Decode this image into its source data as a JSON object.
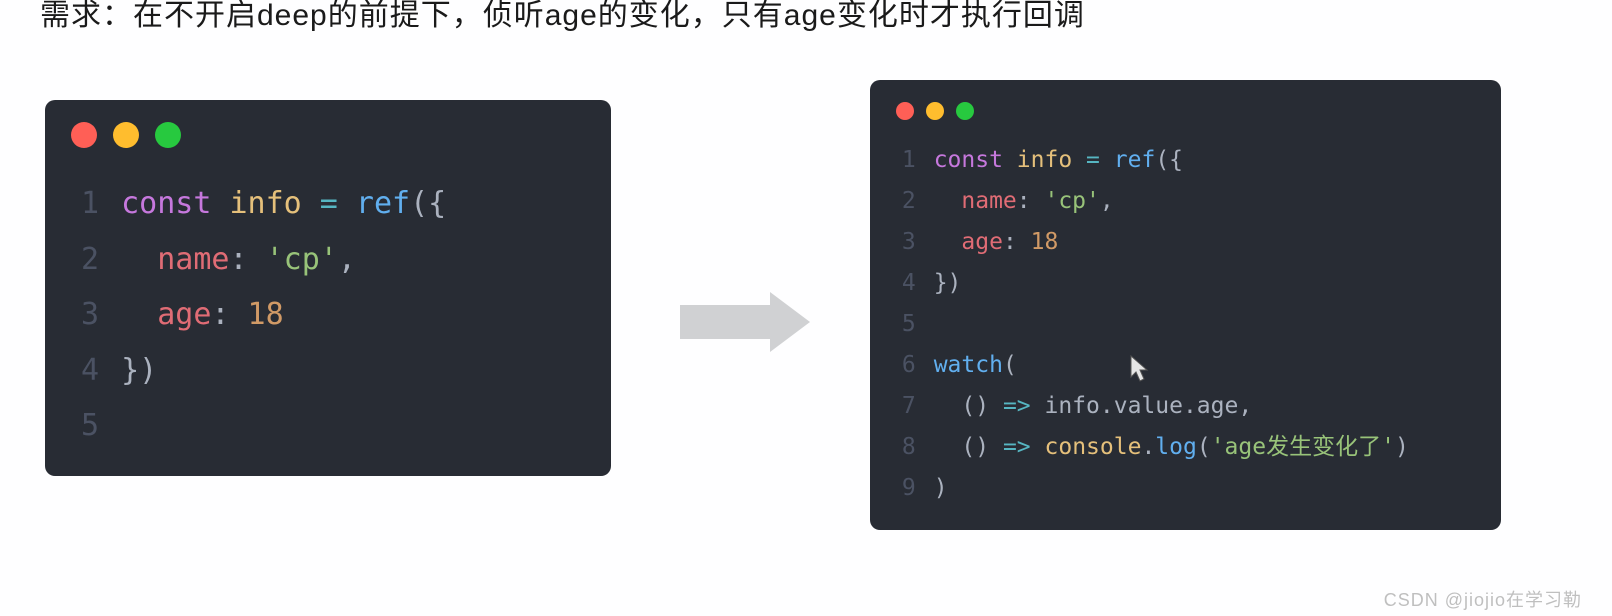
{
  "heading": "需求：在不开启deep的前提下，侦听age的变化，只有age变化时才执行回调",
  "left_code": {
    "lines": [
      {
        "n": "1",
        "tokens": [
          [
            "kw",
            "const"
          ],
          [
            "plain",
            " "
          ],
          [
            "var",
            "info"
          ],
          [
            "plain",
            " "
          ],
          [
            "op",
            "="
          ],
          [
            "plain",
            " "
          ],
          [
            "fn",
            "ref"
          ],
          [
            "plain",
            "({"
          ]
        ]
      },
      {
        "n": "2",
        "tokens": [
          [
            "plain",
            "  "
          ],
          [
            "prop",
            "name"
          ],
          [
            "plain",
            ": "
          ],
          [
            "str",
            "'cp'"
          ],
          [
            "plain",
            ","
          ]
        ]
      },
      {
        "n": "3",
        "tokens": [
          [
            "plain",
            "  "
          ],
          [
            "prop",
            "age"
          ],
          [
            "plain",
            ": "
          ],
          [
            "num",
            "18"
          ]
        ]
      },
      {
        "n": "4",
        "tokens": [
          [
            "plain",
            "})"
          ]
        ]
      },
      {
        "n": "5",
        "tokens": [
          [
            "plain",
            " "
          ]
        ]
      }
    ]
  },
  "right_code": {
    "lines": [
      {
        "n": "1",
        "tokens": [
          [
            "kw",
            "const"
          ],
          [
            "plain",
            " "
          ],
          [
            "var",
            "info"
          ],
          [
            "plain",
            " "
          ],
          [
            "op",
            "="
          ],
          [
            "plain",
            " "
          ],
          [
            "fn",
            "ref"
          ],
          [
            "plain",
            "({"
          ]
        ]
      },
      {
        "n": "2",
        "tokens": [
          [
            "plain",
            "  "
          ],
          [
            "prop",
            "name"
          ],
          [
            "plain",
            ": "
          ],
          [
            "str",
            "'cp'"
          ],
          [
            "plain",
            ","
          ]
        ]
      },
      {
        "n": "3",
        "tokens": [
          [
            "plain",
            "  "
          ],
          [
            "prop",
            "age"
          ],
          [
            "plain",
            ": "
          ],
          [
            "num",
            "18"
          ]
        ]
      },
      {
        "n": "4",
        "tokens": [
          [
            "plain",
            "})"
          ]
        ]
      },
      {
        "n": "5",
        "tokens": [
          [
            "plain",
            " "
          ]
        ]
      },
      {
        "n": "6",
        "tokens": [
          [
            "fn",
            "watch"
          ],
          [
            "plain",
            "("
          ]
        ]
      },
      {
        "n": "7",
        "tokens": [
          [
            "plain",
            "  () "
          ],
          [
            "op",
            "=>"
          ],
          [
            "plain",
            " info.value.age,"
          ]
        ]
      },
      {
        "n": "8",
        "tokens": [
          [
            "plain",
            "  () "
          ],
          [
            "op",
            "=>"
          ],
          [
            "plain",
            " "
          ],
          [
            "var",
            "console"
          ],
          [
            "plain",
            "."
          ],
          [
            "fn",
            "log"
          ],
          [
            "plain",
            "("
          ],
          [
            "str",
            "'age发生变化了'"
          ],
          [
            "plain",
            ")"
          ]
        ]
      },
      {
        "n": "9",
        "tokens": [
          [
            "plain",
            ")"
          ]
        ]
      }
    ]
  },
  "cursor_name": "cursor-icon",
  "watermark": "CSDN @jiojio在学习勒"
}
